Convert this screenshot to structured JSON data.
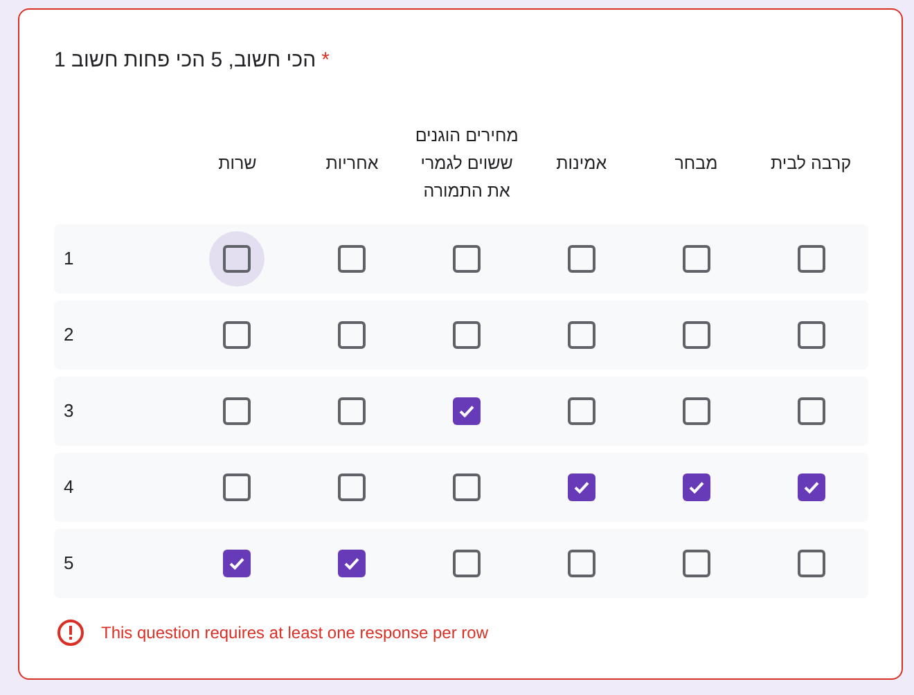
{
  "question": {
    "title": "הכי חשוב, 5 הכי פחות חשוב 1",
    "required_mark": "*"
  },
  "columns": [
    "קרבה לבית",
    "מבחר",
    "אמינות",
    "מחירים הוגנים ששוים לגמרי את התמורה",
    "אחריות",
    "שרות"
  ],
  "rows": [
    {
      "label": "1",
      "cells": [
        {
          "checked": false,
          "hovered": false
        },
        {
          "checked": false,
          "hovered": false
        },
        {
          "checked": false,
          "hovered": false
        },
        {
          "checked": false,
          "hovered": false
        },
        {
          "checked": false,
          "hovered": false
        },
        {
          "checked": false,
          "hovered": true
        }
      ]
    },
    {
      "label": "2",
      "cells": [
        {
          "checked": false,
          "hovered": false
        },
        {
          "checked": false,
          "hovered": false
        },
        {
          "checked": false,
          "hovered": false
        },
        {
          "checked": false,
          "hovered": false
        },
        {
          "checked": false,
          "hovered": false
        },
        {
          "checked": false,
          "hovered": false
        }
      ]
    },
    {
      "label": "3",
      "cells": [
        {
          "checked": false,
          "hovered": false
        },
        {
          "checked": false,
          "hovered": false
        },
        {
          "checked": false,
          "hovered": false
        },
        {
          "checked": true,
          "hovered": false
        },
        {
          "checked": false,
          "hovered": false
        },
        {
          "checked": false,
          "hovered": false
        }
      ]
    },
    {
      "label": "4",
      "cells": [
        {
          "checked": true,
          "hovered": false
        },
        {
          "checked": true,
          "hovered": false
        },
        {
          "checked": true,
          "hovered": false
        },
        {
          "checked": false,
          "hovered": false
        },
        {
          "checked": false,
          "hovered": false
        },
        {
          "checked": false,
          "hovered": false
        }
      ]
    },
    {
      "label": "5",
      "cells": [
        {
          "checked": false,
          "hovered": false
        },
        {
          "checked": false,
          "hovered": false
        },
        {
          "checked": false,
          "hovered": false
        },
        {
          "checked": false,
          "hovered": false
        },
        {
          "checked": true,
          "hovered": false
        },
        {
          "checked": true,
          "hovered": false
        }
      ]
    }
  ],
  "error": {
    "message": "This question requires at least one response per row"
  }
}
